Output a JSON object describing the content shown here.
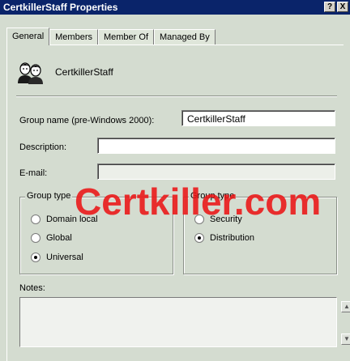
{
  "window": {
    "title": "CertkillerStaff Properties",
    "help_button": "?",
    "close_button": "X"
  },
  "tabs": [
    {
      "label": "General",
      "active": true
    },
    {
      "label": "Members",
      "active": false
    },
    {
      "label": "Member Of",
      "active": false
    },
    {
      "label": "Managed By",
      "active": false
    }
  ],
  "general": {
    "icon": "group-users-icon",
    "object_name": "CertkillerStaff",
    "group_name_label": "Group name (pre-Windows 2000):",
    "group_name_value": "CertkillerStaff",
    "description_label": "Description:",
    "description_value": "",
    "email_label": "E-mail:",
    "email_value": ""
  },
  "group_scope": {
    "title": "Group type",
    "options": [
      {
        "label": "Domain local",
        "selected": false
      },
      {
        "label": "Global",
        "selected": false
      },
      {
        "label": "Universal",
        "selected": true
      }
    ]
  },
  "group_type": {
    "title": "Group type",
    "options": [
      {
        "label": "Security",
        "selected": false
      },
      {
        "label": "Distribution",
        "selected": true
      }
    ]
  },
  "notes": {
    "label": "Notes:",
    "value": ""
  },
  "watermark": "Certkiller.com",
  "colors": {
    "titlebar": "#0a246a",
    "background": "#d4dcd0",
    "watermark": "#eb1414"
  }
}
